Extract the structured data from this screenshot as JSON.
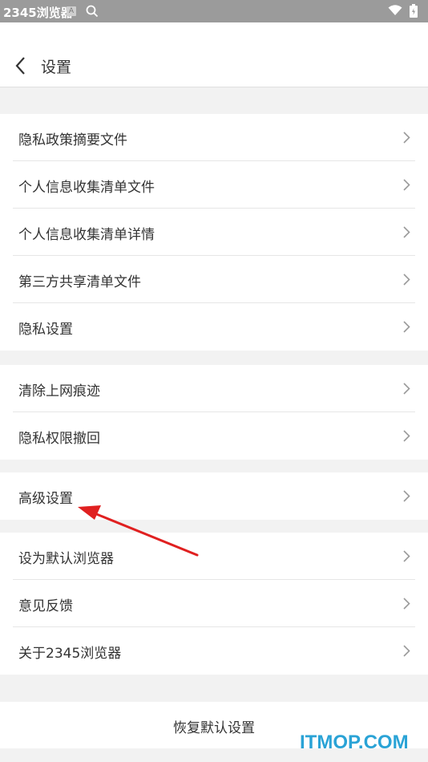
{
  "status_bar": {
    "app_name": "2345浏览器",
    "badge": "A"
  },
  "header": {
    "title": "设置"
  },
  "groups": [
    {
      "items": [
        {
          "label": "隐私政策摘要文件"
        },
        {
          "label": "个人信息收集清单文件"
        },
        {
          "label": "个人信息收集清单详情"
        },
        {
          "label": "第三方共享清单文件"
        },
        {
          "label": "隐私设置"
        }
      ]
    },
    {
      "items": [
        {
          "label": "清除上网痕迹"
        },
        {
          "label": "隐私权限撤回"
        }
      ]
    },
    {
      "items": [
        {
          "label": "高级设置"
        }
      ]
    },
    {
      "items": [
        {
          "label": "设为默认浏览器"
        },
        {
          "label": "意见反馈"
        },
        {
          "label": "关于2345浏览器"
        }
      ]
    }
  ],
  "reset_label": "恢复默认设置",
  "watermark": "ITMOP.COM",
  "colors": {
    "accent_arrow": "#e02020",
    "watermark": "#2aa3d6"
  }
}
